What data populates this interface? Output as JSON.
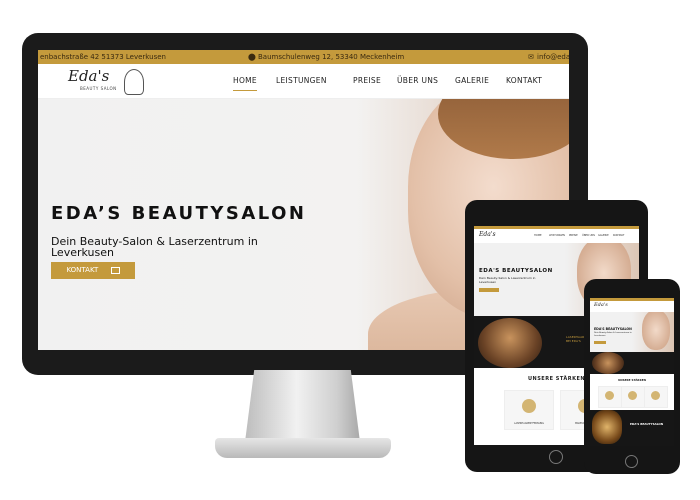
{
  "desktop": {
    "topbar": {
      "address_left": "enbachstraße 42 51373 Leverkusen",
      "address_center": "Baumschulenweg 12, 53340 Meckenheim",
      "email": "info@eda"
    },
    "logo": {
      "script": "Eda's",
      "sub": "BEAUTY SALON"
    },
    "nav": [
      "HOME",
      "LEISTUNGEN",
      "PREISE",
      "ÜBER UNS",
      "GALERIE",
      "KONTAKT"
    ],
    "hero": {
      "title": "EDA’S BEAUTYSALON",
      "subtitle": "Dein Beauty-Salon & Laserzentrum in Leverkusen",
      "button": "KONTAKT"
    }
  },
  "tablet": {
    "title": "EDA'S BEAUTYSALON",
    "subtitle": "Dein Beauty-Salon & Laserzentrum in Leverkusen",
    "dark_text_1": "LASERHAAR",
    "dark_text_2": "BEI EDA'S",
    "section_title": "UNSERE STÄRKEN",
    "card_1": "LASERHAARENTFERNUNG",
    "card_2": "MAKEUP-STYLING"
  },
  "phone": {
    "title": "EDA'S BEAUTYSALON",
    "section_title": "UNSERE STÄRKEN",
    "bottom_text": "EDA'S BEAUTYSALON"
  },
  "colors": {
    "accent": "#c49a3c",
    "dark": "#161616"
  }
}
